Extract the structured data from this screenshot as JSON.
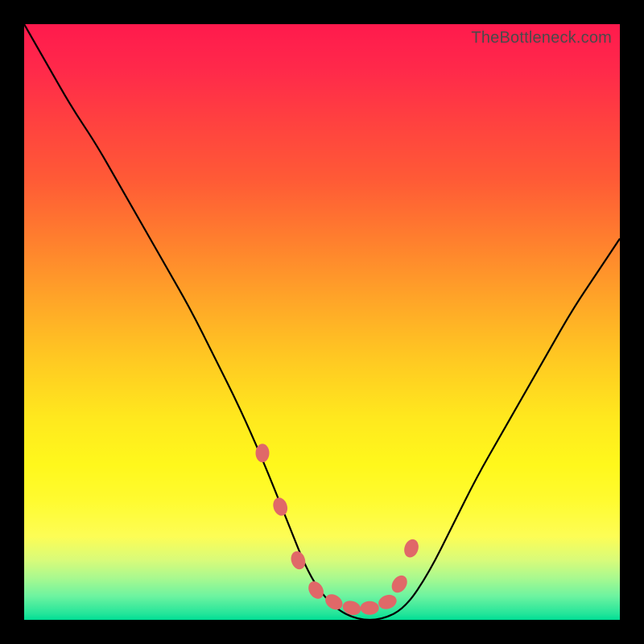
{
  "watermark": "TheBottleneck.com",
  "chart_data": {
    "type": "line",
    "title": "",
    "xlabel": "",
    "ylabel": "",
    "xlim": [
      0,
      100
    ],
    "ylim": [
      0,
      100
    ],
    "series": [
      {
        "name": "bottleneck-curve",
        "x": [
          0,
          4,
          8,
          12,
          16,
          20,
          24,
          28,
          32,
          36,
          40,
          44,
          48,
          52,
          56,
          60,
          64,
          68,
          72,
          76,
          80,
          84,
          88,
          92,
          96,
          100
        ],
        "values": [
          100,
          93,
          86,
          80,
          73,
          66,
          59,
          52,
          44,
          36,
          27,
          17,
          7,
          2,
          0,
          0,
          2,
          8,
          16,
          24,
          31,
          38,
          45,
          52,
          58,
          64
        ]
      }
    ],
    "markers": {
      "name": "highlight-beads",
      "x": [
        40,
        43,
        46,
        49,
        52,
        55,
        58,
        61,
        63,
        65
      ],
      "values": [
        28,
        19,
        10,
        5,
        3,
        2,
        2,
        3,
        6,
        12
      ]
    }
  }
}
